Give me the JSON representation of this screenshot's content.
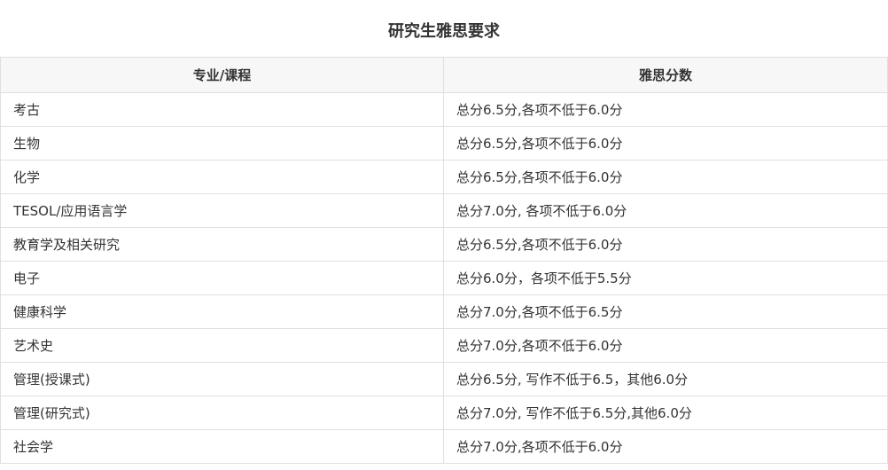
{
  "title": "研究生雅思要求",
  "table": {
    "headers": [
      "专业/课程",
      "雅思分数"
    ],
    "rows": [
      [
        "考古",
        "总分6.5分,各项不低于6.0分"
      ],
      [
        "生物",
        "总分6.5分,各项不低于6.0分"
      ],
      [
        "化学",
        "总分6.5分,各项不低于6.0分"
      ],
      [
        "TESOL/应用语言学",
        "总分7.0分, 各项不低于6.0分"
      ],
      [
        "教育学及相关研究",
        "总分6.5分,各项不低于6.0分"
      ],
      [
        "电子",
        "总分6.0分，各项不低于5.5分"
      ],
      [
        "健康科学",
        "总分7.0分,各项不低于6.5分"
      ],
      [
        "艺术史",
        "总分7.0分,各项不低于6.0分"
      ],
      [
        "管理(授课式)",
        "总分6.5分, 写作不低于6.5，其他6.0分"
      ],
      [
        "管理(研究式)",
        "总分7.0分, 写作不低于6.5分,其他6.0分"
      ],
      [
        "社会学",
        "总分7.0分,各项不低于6.0分"
      ]
    ]
  }
}
